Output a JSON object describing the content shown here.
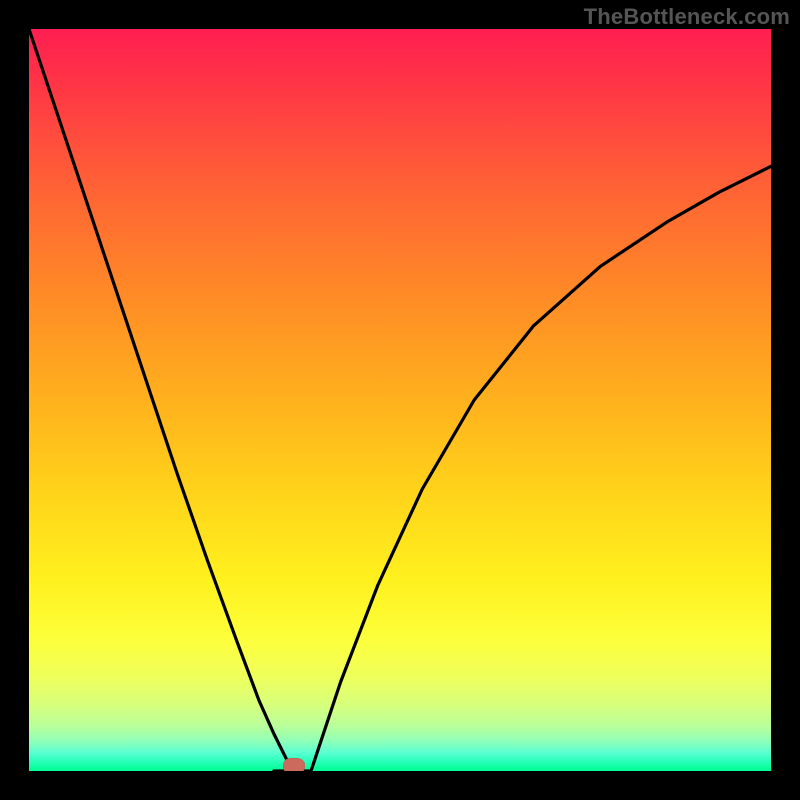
{
  "watermark": "TheBottleneck.com",
  "marker": {
    "x_frac": 0.357,
    "y_frac": 0.993
  },
  "chart_data": {
    "type": "line",
    "title": "",
    "xlabel": "",
    "ylabel": "",
    "xlim": [
      0,
      1
    ],
    "ylim": [
      0,
      1
    ],
    "series": [
      {
        "name": "left-branch",
        "x": [
          0.0,
          0.04,
          0.08,
          0.12,
          0.16,
          0.2,
          0.24,
          0.28,
          0.31,
          0.33,
          0.345,
          0.355
        ],
        "y": [
          1.0,
          0.88,
          0.76,
          0.64,
          0.52,
          0.4,
          0.285,
          0.175,
          0.095,
          0.05,
          0.02,
          0.0
        ]
      },
      {
        "name": "flat-bottom",
        "x": [
          0.33,
          0.38
        ],
        "y": [
          0.0,
          0.0
        ]
      },
      {
        "name": "right-branch",
        "x": [
          0.38,
          0.42,
          0.47,
          0.53,
          0.6,
          0.68,
          0.77,
          0.86,
          0.93,
          1.0
        ],
        "y": [
          0.0,
          0.12,
          0.25,
          0.38,
          0.5,
          0.6,
          0.68,
          0.74,
          0.78,
          0.815
        ]
      }
    ],
    "gradient_stops": [
      {
        "pos": 0.0,
        "color": "#ff1f52"
      },
      {
        "pos": 0.5,
        "color": "#ffb11d"
      },
      {
        "pos": 0.82,
        "color": "#fdff3a"
      },
      {
        "pos": 1.0,
        "color": "#00ff90"
      }
    ],
    "marker": {
      "x": 0.357,
      "y": 0.007
    }
  }
}
